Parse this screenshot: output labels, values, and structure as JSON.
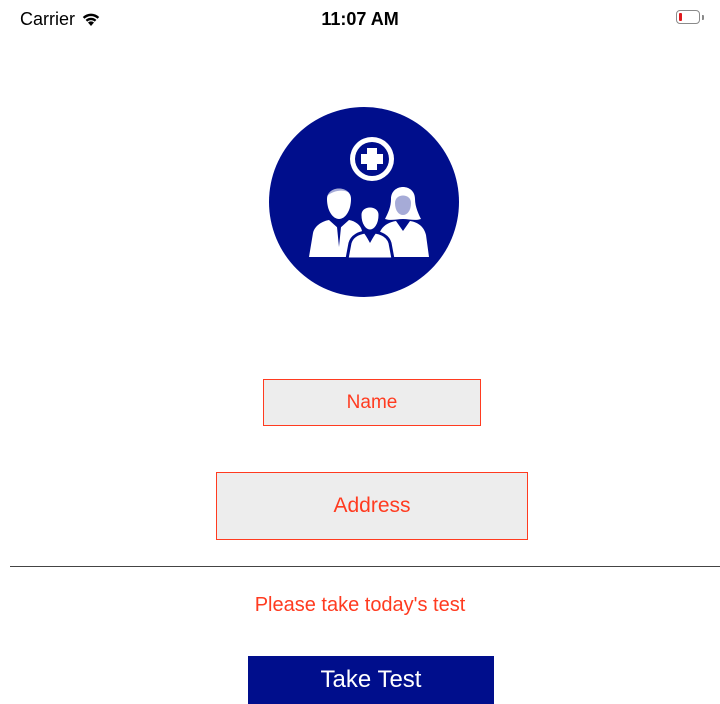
{
  "status_bar": {
    "carrier": "Carrier",
    "time": "11:07 AM",
    "battery_level": 0.15,
    "battery_color": "#e0191e"
  },
  "logo": {
    "icon": "family-health-icon",
    "color": "#000e8c"
  },
  "form": {
    "name_placeholder": "Name",
    "address_placeholder": "Address",
    "border_color": "#ff3b20",
    "fill_color": "#ededed"
  },
  "prompt": {
    "text": "Please take today's test",
    "color": "#ff3b20"
  },
  "actions": {
    "take_test_label": "Take Test",
    "button_color": "#000e8c"
  }
}
